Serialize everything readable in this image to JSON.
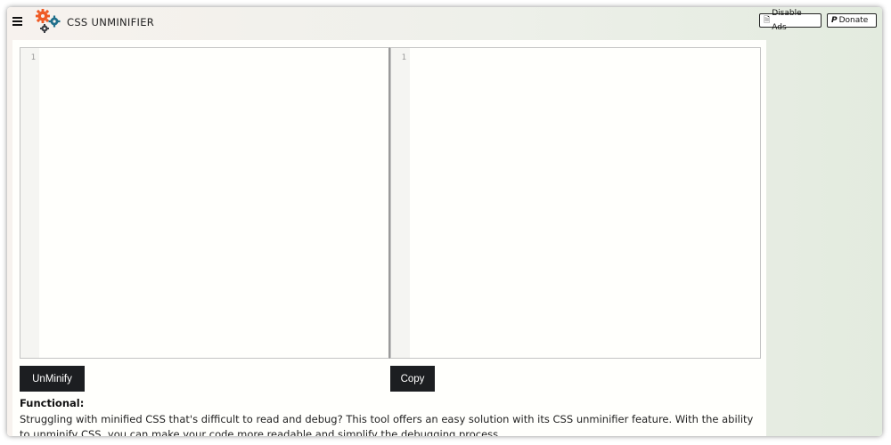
{
  "header": {
    "title": "CSS UNMINIFIER",
    "disable_ads_label": "Disable Ads",
    "donate_label": "Donate"
  },
  "icons": {
    "menu": "hamburger-icon",
    "logo": "gears-logo-icon",
    "disable_ads": "document-icon",
    "donate": "paypal-icon"
  },
  "colors": {
    "gear_orange": "#ef5a24",
    "gear_blue": "#1f6f8b",
    "gear_dark": "#3b3f45",
    "button_dark": "#1c1e21"
  },
  "editors": {
    "input": {
      "line_number": "1",
      "value": ""
    },
    "output": {
      "line_number": "1",
      "value": ""
    }
  },
  "actions": {
    "unminify_label": "UnMinify",
    "copy_label": "Copy"
  },
  "info": {
    "heading": "Functional:",
    "text": "Struggling with minified CSS that's difficult to read and debug? This tool offers an easy solution with its CSS unminifier feature. With the ability to unminify CSS, you can make your code more readable and simplify the debugging process."
  }
}
